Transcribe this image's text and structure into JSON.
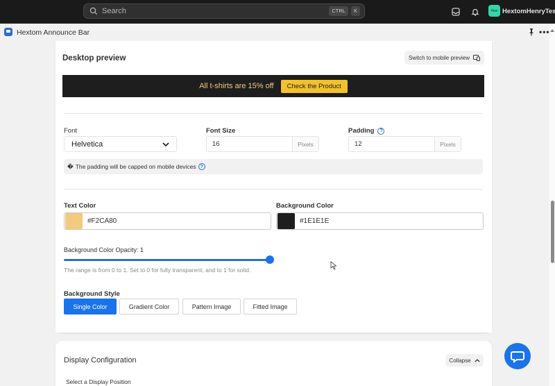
{
  "topbar": {
    "search_placeholder": "Search",
    "shortcut_keys": [
      "CTRL",
      "K"
    ],
    "store_badge": "Hexi",
    "store_name": "HextomHenryTest"
  },
  "app": {
    "title": "Hextom Announce Bar"
  },
  "preview": {
    "title": "Desktop preview",
    "switch_label": "Switch to mobile preview",
    "announcement_text": "All t-shirts are 15% off",
    "cta_label": "Check the Product",
    "text_color": "#F2CA80",
    "background_color": "#1E1E1E",
    "cta_color": "#F2C12E"
  },
  "typography": {
    "font_label": "Font",
    "font_value": "Helvetica",
    "font_size_label": "Font Size",
    "font_size_value": "16",
    "font_size_unit": "Pixels",
    "padding_label": "Padding",
    "padding_value": "12",
    "padding_unit": "Pixels",
    "info_prefix": "�",
    "info_text": "The padding will be capped on mobile devices"
  },
  "colors": {
    "text_color_label": "Text Color",
    "text_color_value": "#F2CA80",
    "background_color_label": "Background Color",
    "background_color_value": "#1E1E1E",
    "opacity_label": "Background Color Opacity: 1",
    "opacity_value": 1,
    "opacity_help": "The range is from 0 to 1. Set to 0 for fully transparent, and to 1 for solid."
  },
  "background_style": {
    "label": "Background Style",
    "options": [
      "Single Color",
      "Gradient Color",
      "Pattern Image",
      "Fitted Image"
    ],
    "selected": "Single Color"
  },
  "display_config": {
    "title": "Display Configuration",
    "collapse_label": "Collapse",
    "position_label": "Select a Display Position"
  },
  "accent_color": "#1A73E8"
}
